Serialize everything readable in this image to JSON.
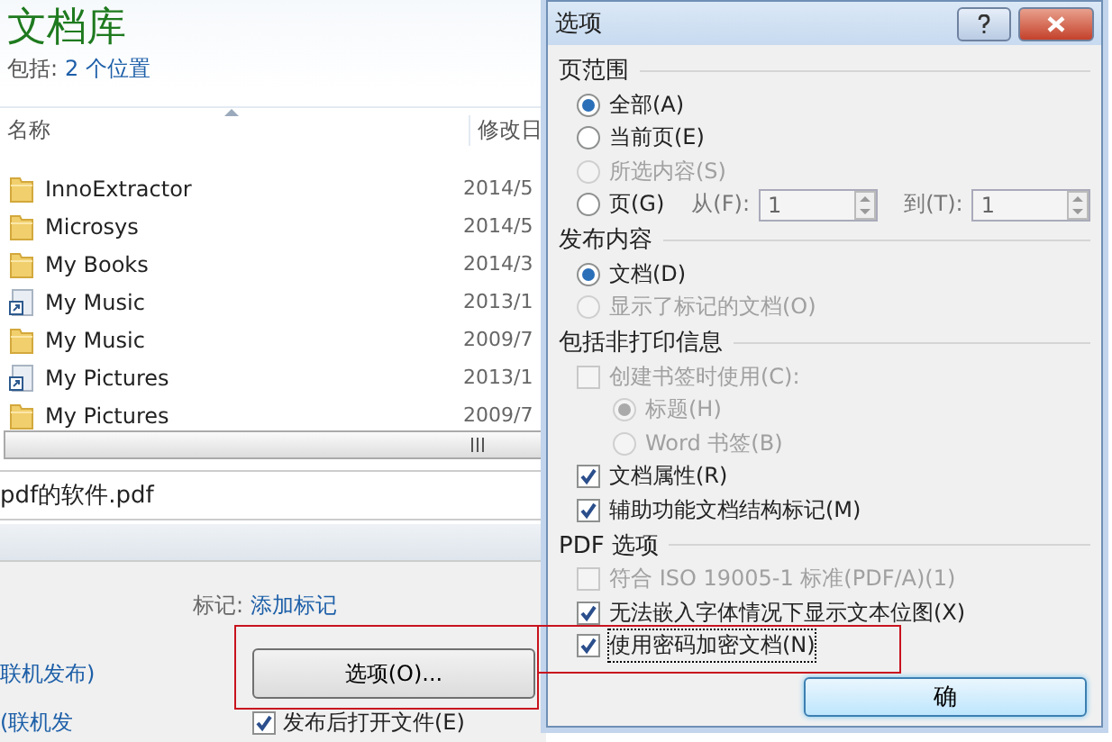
{
  "library": {
    "title": "文档库",
    "includes_label": "包括:",
    "locations_link": "2 个位置",
    "columns": [
      "名称",
      "修改日"
    ],
    "files": [
      {
        "kind": "folder",
        "name": "InnoExtractor",
        "date": "2014/5"
      },
      {
        "kind": "folder",
        "name": "Microsys",
        "date": "2014/5"
      },
      {
        "kind": "folder",
        "name": "My Books",
        "date": "2014/3"
      },
      {
        "kind": "shortcut",
        "name": "My Music",
        "date": "2013/1"
      },
      {
        "kind": "folder",
        "name": "My Music",
        "date": "2009/7"
      },
      {
        "kind": "shortcut",
        "name": "My Pictures",
        "date": "2013/1"
      },
      {
        "kind": "folder",
        "name": "My Pictures",
        "date": "2009/7"
      }
    ],
    "file_name": "pdf的软件.pdf",
    "tags_label": "标记:",
    "tags_link": "添加标记",
    "left_texts": [
      "联机发布)",
      "(联机发"
    ],
    "options_button": "选项(O)...",
    "open_after": {
      "label": "发布后打开文件(E)",
      "checked": true
    }
  },
  "dialog": {
    "title": "选项",
    "sections": [
      {
        "title": "页范围",
        "items": [
          {
            "kind": "radio",
            "label": "全部(A)",
            "selected": true,
            "disabled": false
          },
          {
            "kind": "radio",
            "label": "当前页(E)",
            "selected": false,
            "disabled": false
          },
          {
            "kind": "radio",
            "label": "所选内容(S)",
            "selected": false,
            "disabled": true
          },
          {
            "kind": "range",
            "label": "页(G)",
            "selected": false,
            "disabled": false,
            "from_label": "从(F):",
            "from_value": "1",
            "to_label": "到(T):",
            "to_value": "1"
          }
        ]
      },
      {
        "title": "发布内容",
        "items": [
          {
            "kind": "radio",
            "label": "文档(D)",
            "selected": true,
            "disabled": false
          },
          {
            "kind": "radio",
            "label": "显示了标记的文档(O)",
            "selected": false,
            "disabled": true
          }
        ]
      },
      {
        "title": "包括非打印信息",
        "items": [
          {
            "kind": "checkbox",
            "label": "创建书签时使用(C):",
            "checked": false,
            "disabled": true,
            "focused": false,
            "children": [
              {
                "kind": "radio",
                "label": "标题(H)",
                "selected": true,
                "disabled": true
              },
              {
                "kind": "radio",
                "label": "Word 书签(B)",
                "selected": false,
                "disabled": true
              }
            ]
          },
          {
            "kind": "checkbox",
            "label": "文档属性(R)",
            "checked": true,
            "disabled": false,
            "focused": false
          },
          {
            "kind": "checkbox",
            "label": "辅助功能文档结构标记(M)",
            "checked": true,
            "disabled": false,
            "focused": false
          }
        ]
      },
      {
        "title": "PDF 选项",
        "items": [
          {
            "kind": "checkbox",
            "label": "符合 ISO 19005-1 标准(PDF/A)(1)",
            "checked": false,
            "disabled": true,
            "focused": false
          },
          {
            "kind": "checkbox",
            "label": "无法嵌入字体情况下显示文本位图(X)",
            "checked": true,
            "disabled": false,
            "focused": false
          },
          {
            "kind": "checkbox",
            "label": "使用密码加密文档(N)",
            "checked": true,
            "disabled": false,
            "focused": true
          }
        ]
      }
    ],
    "ok_button": "确"
  }
}
